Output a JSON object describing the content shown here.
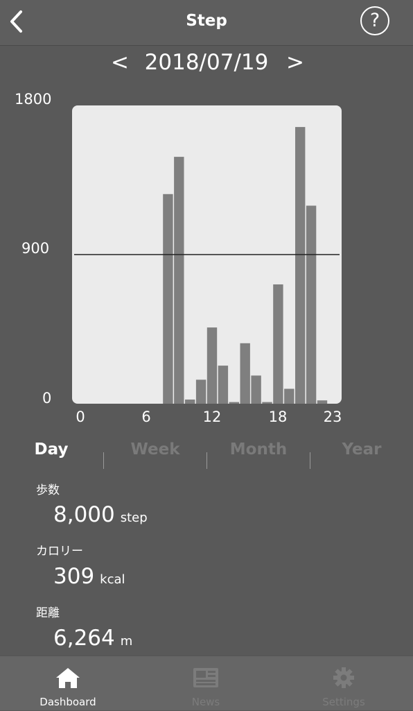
{
  "header": {
    "title": "Step",
    "back_icon": "chevron-left-icon",
    "help_label": "?"
  },
  "date_nav": {
    "prev": "<",
    "date": "2018/07/19",
    "next": ">"
  },
  "chart_data": {
    "type": "bar",
    "title": "",
    "xlabel": "",
    "ylabel": "",
    "x": [
      0,
      1,
      2,
      3,
      4,
      5,
      6,
      7,
      8,
      9,
      10,
      11,
      12,
      13,
      14,
      15,
      16,
      17,
      18,
      19,
      20,
      21,
      22,
      23
    ],
    "values": [
      0,
      0,
      0,
      0,
      0,
      0,
      0,
      0,
      1265,
      1490,
      25,
      145,
      460,
      230,
      10,
      365,
      170,
      10,
      720,
      90,
      1670,
      1195,
      20,
      0
    ],
    "ylim": [
      0,
      1800
    ],
    "y_ticks": [
      "1800",
      "900",
      "0"
    ],
    "x_ticks": [
      "0",
      "6",
      "12",
      "18",
      "23"
    ],
    "reference_line": 900,
    "grid": false
  },
  "tabs": [
    {
      "label": "Day",
      "active": true
    },
    {
      "label": "Week",
      "active": false
    },
    {
      "label": "Month",
      "active": false
    },
    {
      "label": "Year",
      "active": false
    }
  ],
  "stats": {
    "steps": {
      "label": "歩数",
      "value": "8,000",
      "unit": "step"
    },
    "calories": {
      "label": "カロリー",
      "value": "309",
      "unit": "kcal"
    },
    "distance": {
      "label": "距離",
      "value": "6,264",
      "unit": "m"
    }
  },
  "tabbar": {
    "dashboard": {
      "label": "Dashboard",
      "icon": "home-icon"
    },
    "news": {
      "label": "News",
      "icon": "newspaper-icon"
    },
    "settings": {
      "label": "Settings",
      "icon": "gear-icon"
    }
  },
  "colors": {
    "background": "#595959",
    "plot_area": "#ebebeb",
    "bar": "#7f7f7f",
    "active": "#ffffff",
    "inactive": "#7a7a7a"
  }
}
